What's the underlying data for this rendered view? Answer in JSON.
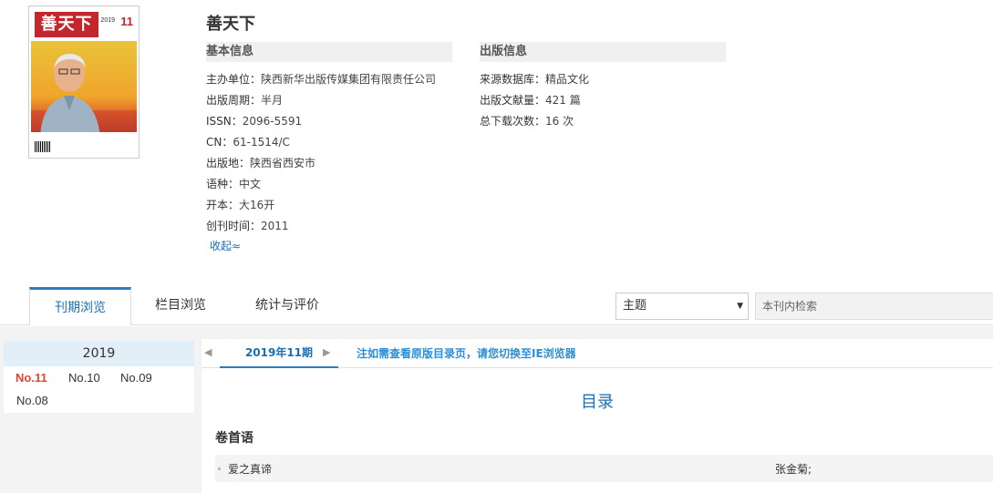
{
  "cover": {
    "logo": "善天下",
    "year": "2019",
    "issue": "11"
  },
  "journal": {
    "title": "善天下"
  },
  "basic_info": {
    "heading": "基本信息",
    "rows": [
      {
        "label": "主办单位：",
        "value": "陕西新华出版传媒集团有限责任公司"
      },
      {
        "label": "出版周期：",
        "value": "半月"
      },
      {
        "label": "ISSN：",
        "value": "2096-5591"
      },
      {
        "label": "CN：",
        "value": "61-1514/C"
      },
      {
        "label": "出版地：",
        "value": "陕西省西安市"
      },
      {
        "label": "语种：",
        "value": "中文"
      },
      {
        "label": "开本：",
        "value": "大16开"
      },
      {
        "label": "创刊时间：",
        "value": "2011"
      }
    ],
    "collapse_label": "收起≈"
  },
  "pub_info": {
    "heading": "出版信息",
    "rows": [
      {
        "label": "来源数据库：",
        "value": "精品文化"
      },
      {
        "label": "出版文献量：",
        "value": "421 篇"
      },
      {
        "label": "总下载次数：",
        "value": "16 次"
      }
    ]
  },
  "tabs": [
    {
      "label": "刊期浏览",
      "active": true
    },
    {
      "label": "栏目浏览",
      "active": false
    },
    {
      "label": "统计与评价",
      "active": false
    }
  ],
  "search": {
    "select_value": "主题",
    "placeholder": "本刊内检索"
  },
  "years": {
    "year": "2019",
    "issues": [
      "No.11",
      "No.10",
      "No.09",
      "No.08"
    ],
    "current": "No.11"
  },
  "toc": {
    "current_issue": "2019年11期",
    "notice": "注如需查看原版目录页，请您切换至IE浏览器",
    "title": "目录",
    "section": "卷首语",
    "articles": [
      {
        "title": "爱之真谛",
        "author": "张金菊;"
      }
    ]
  },
  "colors": {
    "accent": "#1a6eb3",
    "current_issue": "#e0452f",
    "panel_bg": "#f3f3f3"
  }
}
